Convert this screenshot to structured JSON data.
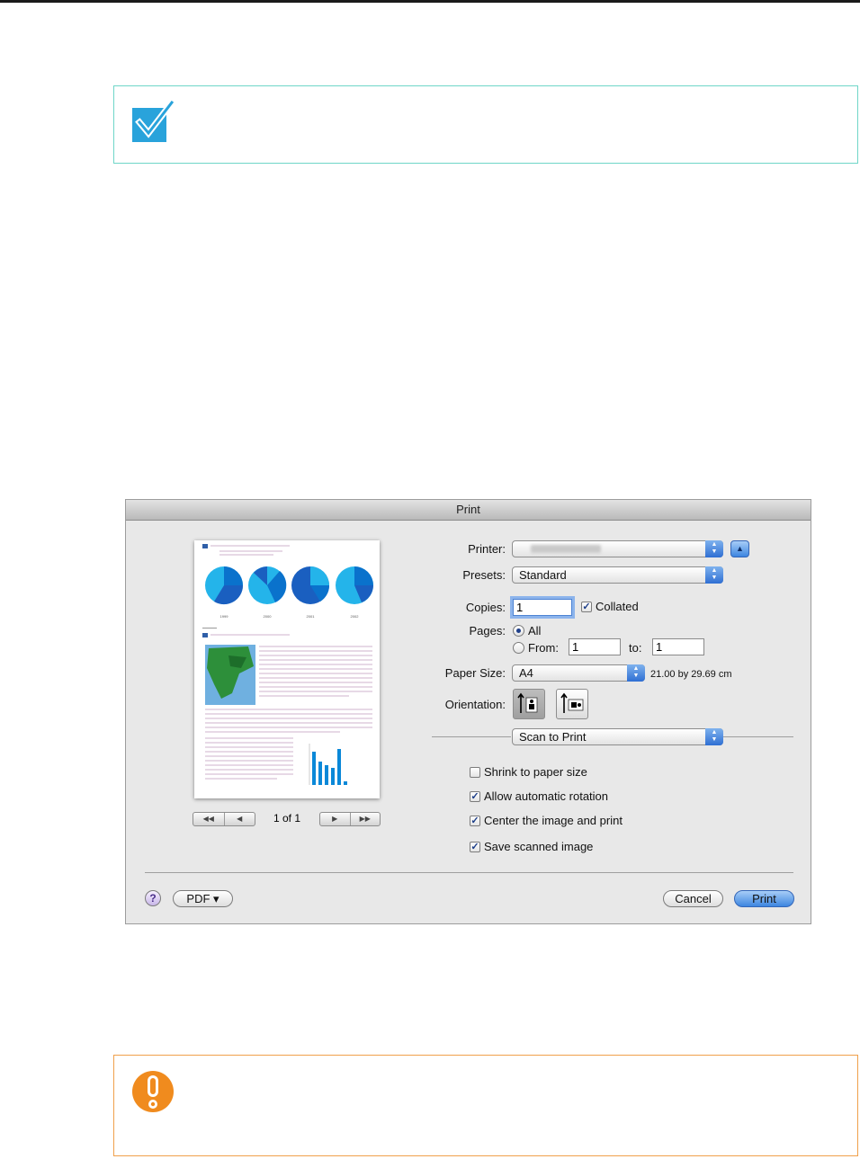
{
  "colors": {
    "hint_border": "#6fd6c8",
    "warn_border": "#f0a04b",
    "check_blue": "#29a3db",
    "warn_orange": "#f08b1e",
    "accent_blue": "#3d86e0"
  },
  "dialog": {
    "title": "Print",
    "preview": {
      "page_indicator": "1 of 1",
      "nav_first": "◀◀",
      "nav_prev": "◀",
      "nav_next": "▶",
      "nav_last": "▶▶",
      "pie_labels": [
        "1999",
        "2000",
        "2001",
        "2002"
      ]
    },
    "printer": {
      "label": "Printer:"
    },
    "presets": {
      "label": "Presets:",
      "value": "Standard"
    },
    "copies": {
      "label": "Copies:",
      "value": "1",
      "collated_label": "Collated",
      "collated": true
    },
    "pages": {
      "label": "Pages:",
      "all_label": "All",
      "from_label": "From:",
      "from_value": "1",
      "to_label": "to:",
      "to_value": "1",
      "selected": "All"
    },
    "paper_size": {
      "label": "Paper Size:",
      "value": "A4",
      "dimensions": "21.00 by 29.69 cm"
    },
    "orientation": {
      "label": "Orientation:",
      "selected": "portrait"
    },
    "section": {
      "value": "Scan to Print"
    },
    "options": [
      {
        "label": "Shrink to paper size",
        "checked": false
      },
      {
        "label": "Allow automatic rotation",
        "checked": true
      },
      {
        "label": "Center the image and print",
        "checked": true
      },
      {
        "label": "Save scanned image",
        "checked": true
      }
    ],
    "buttons": {
      "help": "?",
      "pdf": "PDF ▾",
      "cancel": "Cancel",
      "print": "Print"
    }
  }
}
